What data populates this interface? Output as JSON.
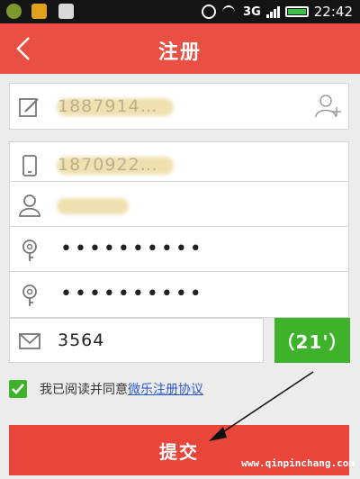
{
  "status_bar": {
    "network": "3G",
    "time": "22:42"
  },
  "header": {
    "title": "注册",
    "back_icon": "chevron-left-icon"
  },
  "form": {
    "fields": [
      {
        "name": "username",
        "icon": "edit-icon",
        "value": "1887914…"
      },
      {
        "name": "phone",
        "icon": "phone-icon",
        "value": "1870922…"
      },
      {
        "name": "nickname",
        "icon": "user-icon",
        "value": ""
      },
      {
        "name": "password",
        "icon": "key-icon",
        "value": "••••••••••"
      },
      {
        "name": "confirm_password",
        "icon": "key-icon",
        "value": "••••••••••"
      }
    ],
    "code": {
      "icon": "mail-icon",
      "value": "3564"
    },
    "code_button": "（21'）",
    "agree": {
      "prefix": "我已阅读并同意",
      "link": "微乐注册协议"
    },
    "submit": "提交"
  },
  "watermark": "www.qinpinchang.com",
  "colors": {
    "header": "#ea4f44",
    "submit": "#e8463b",
    "code_button": "#3fb22c",
    "link": "#2d59c9"
  }
}
